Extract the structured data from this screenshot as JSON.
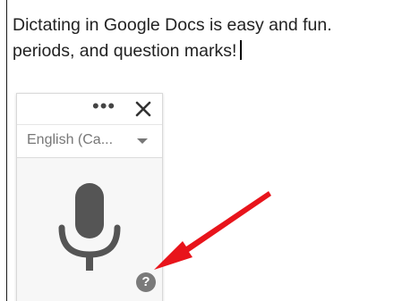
{
  "document": {
    "lines": [
      "Dictating in Google Docs is easy and fun.",
      "periods, and question marks!"
    ]
  },
  "voice_typing": {
    "more_label": "•••",
    "language": "English (Ca...",
    "help_label": "?"
  },
  "colors": {
    "mic": "#555555",
    "annotation_arrow": "#e8141b",
    "help_bg": "#7a7a7a"
  },
  "icons": [
    "more-options-icon",
    "close-icon",
    "chevron-down-icon",
    "microphone-icon",
    "help-icon",
    "red-arrow"
  ]
}
